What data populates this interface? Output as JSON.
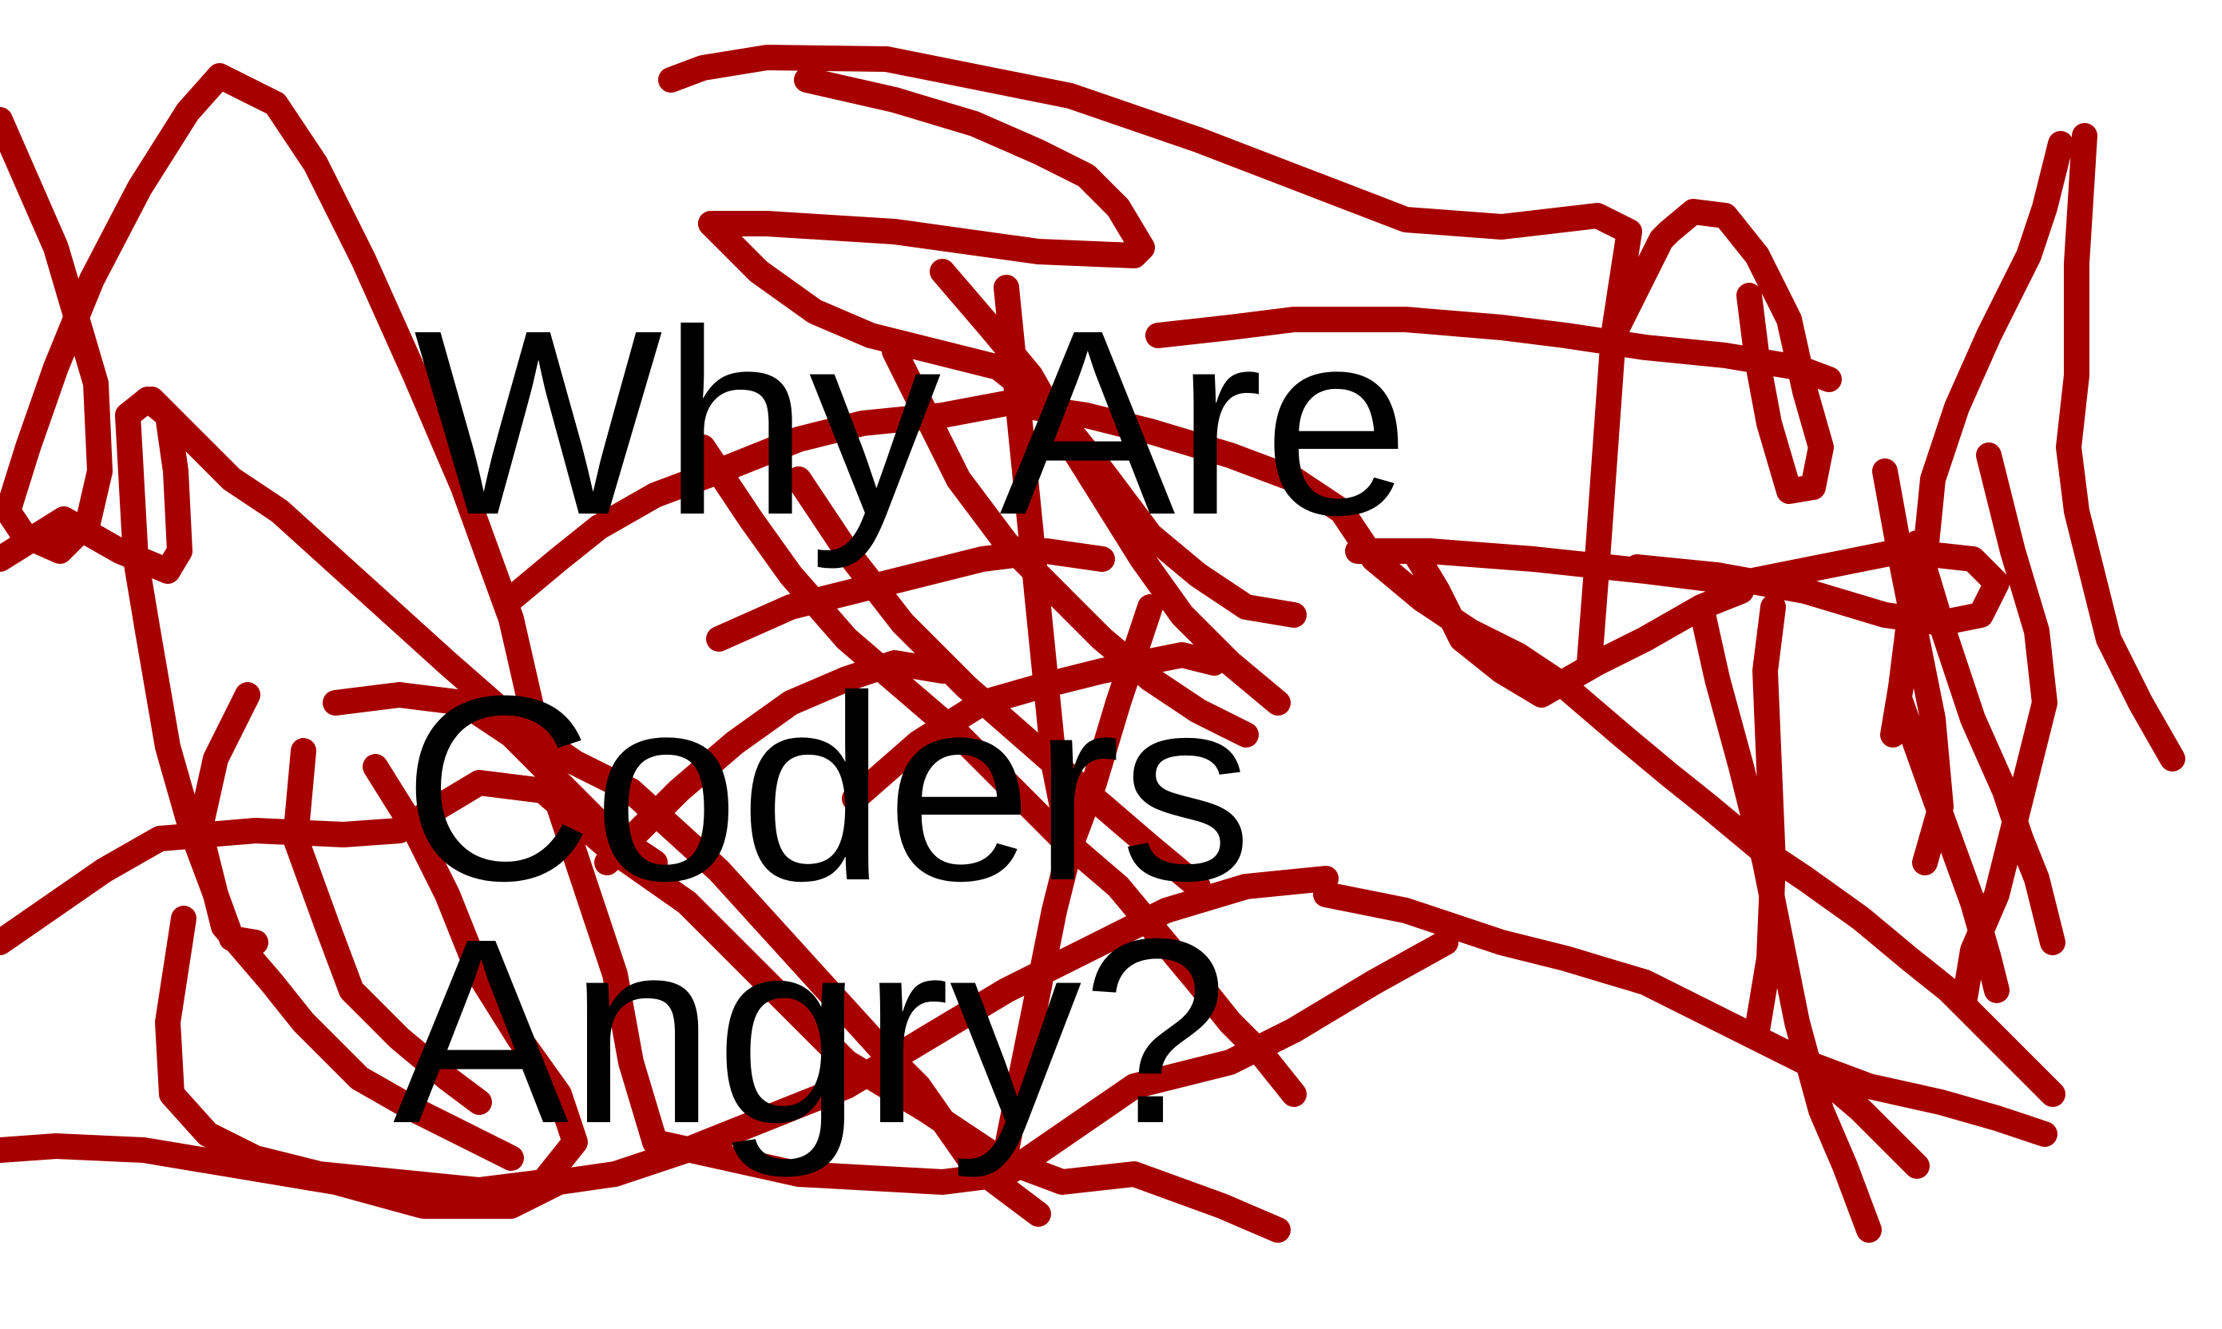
{
  "headline": {
    "lines": [
      "Why Are",
      "Coders",
      "Angry?"
    ]
  },
  "colors": {
    "scribble": "#a70000",
    "text": "#000000",
    "background": "#ffffff"
  }
}
